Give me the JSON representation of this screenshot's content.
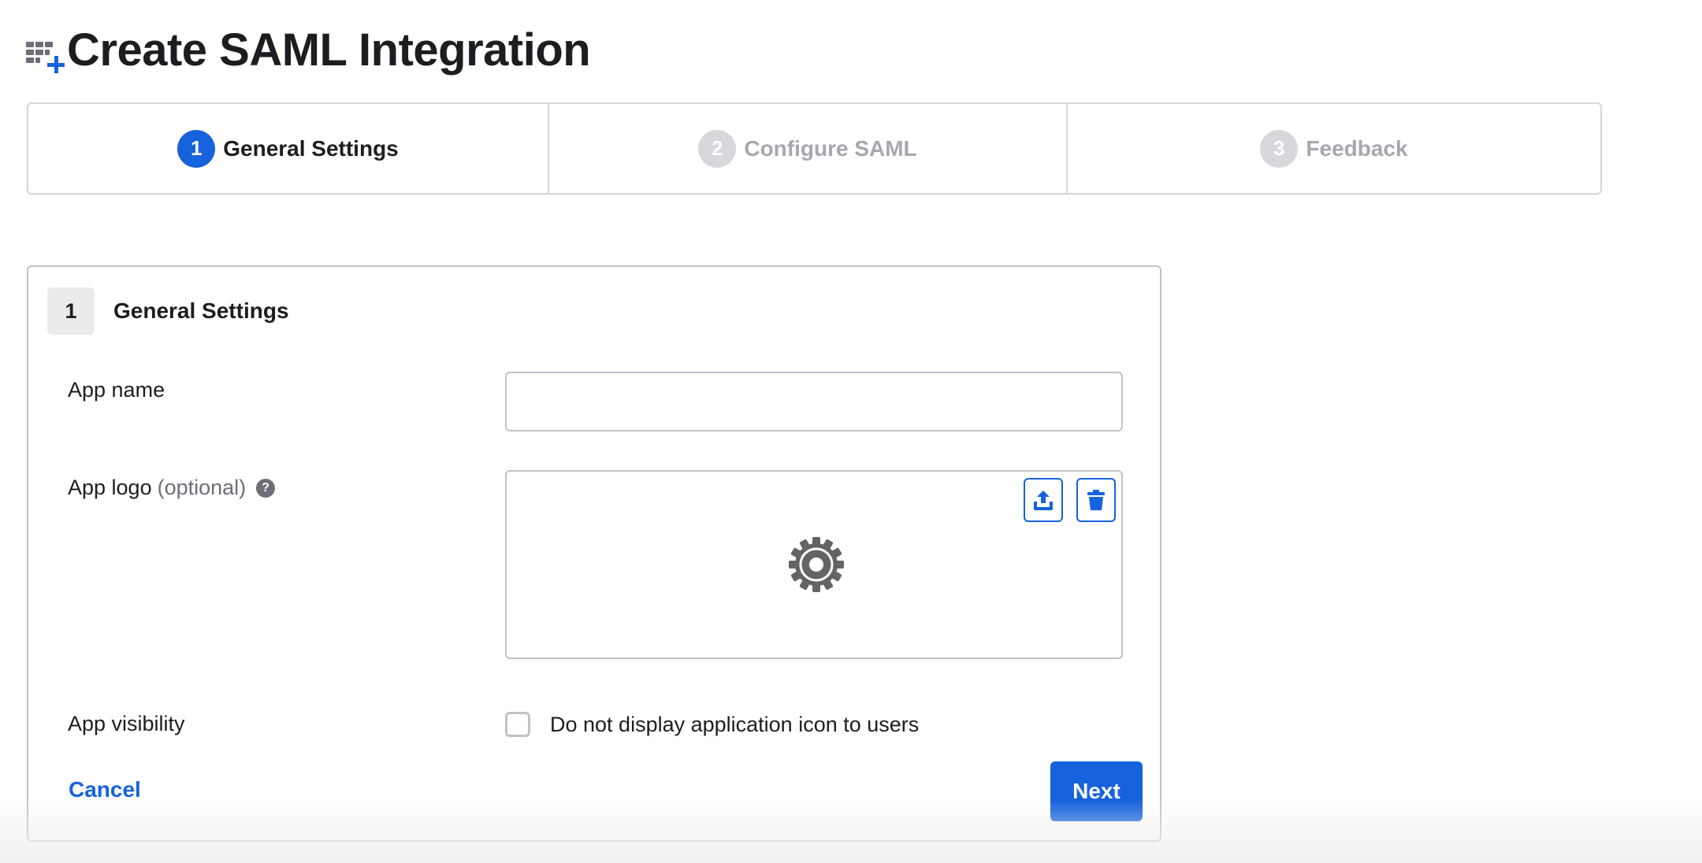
{
  "page": {
    "title": "Create SAML Integration",
    "title_icon": "app-grid-plus-icon"
  },
  "stepper": {
    "steps": [
      {
        "number": "1",
        "label": "General Settings",
        "state": "active"
      },
      {
        "number": "2",
        "label": "Configure SAML",
        "state": "inactive"
      },
      {
        "number": "3",
        "label": "Feedback",
        "state": "inactive"
      }
    ]
  },
  "form": {
    "section_number": "1",
    "section_title": "General Settings",
    "app_name": {
      "label": "App name",
      "value": "",
      "placeholder": ""
    },
    "app_logo": {
      "label": "App logo",
      "optional_label": "(optional)",
      "help_icon": "?",
      "upload_icon": "upload-icon",
      "delete_icon": "trash-icon",
      "placeholder_icon": "gear-icon"
    },
    "app_visibility": {
      "label": "App visibility",
      "checkbox_label": "Do not display application icon to users",
      "checked": false
    },
    "cancel_label": "Cancel",
    "next_label": "Next"
  },
  "colors": {
    "accent": "#1662dd",
    "text": "#1d1d21",
    "muted": "#6e6e78",
    "inactive_step": "#d7d7dc",
    "border": "#c1c1c8"
  }
}
